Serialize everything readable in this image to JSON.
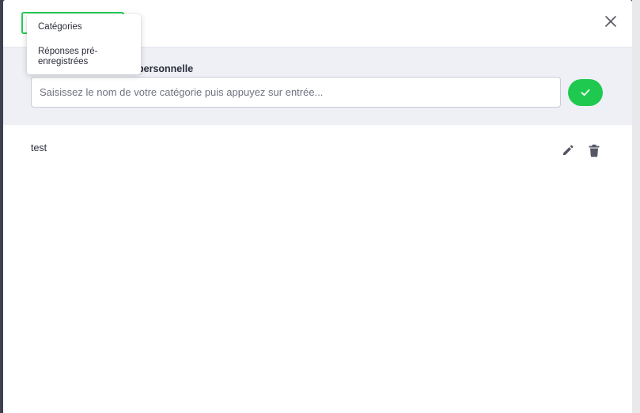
{
  "header": {
    "close_icon": "close-icon"
  },
  "menu": {
    "items": [
      {
        "label": "Catégories"
      },
      {
        "label": "Réponses pré-enregistrées"
      }
    ]
  },
  "create_form": {
    "label": "personnelle",
    "placeholder": "Saisissez le nom de votre catégorie puis appuyez sur entrée...",
    "confirm_icon": "check-icon"
  },
  "categories": [
    {
      "name": "test",
      "edit_icon": "pencil-icon",
      "delete_icon": "trash-icon"
    }
  ],
  "colors": {
    "accent": "#1fc94f",
    "section_bg": "#eef0f6",
    "icon": "#555866",
    "text": "#2b2d3a"
  }
}
